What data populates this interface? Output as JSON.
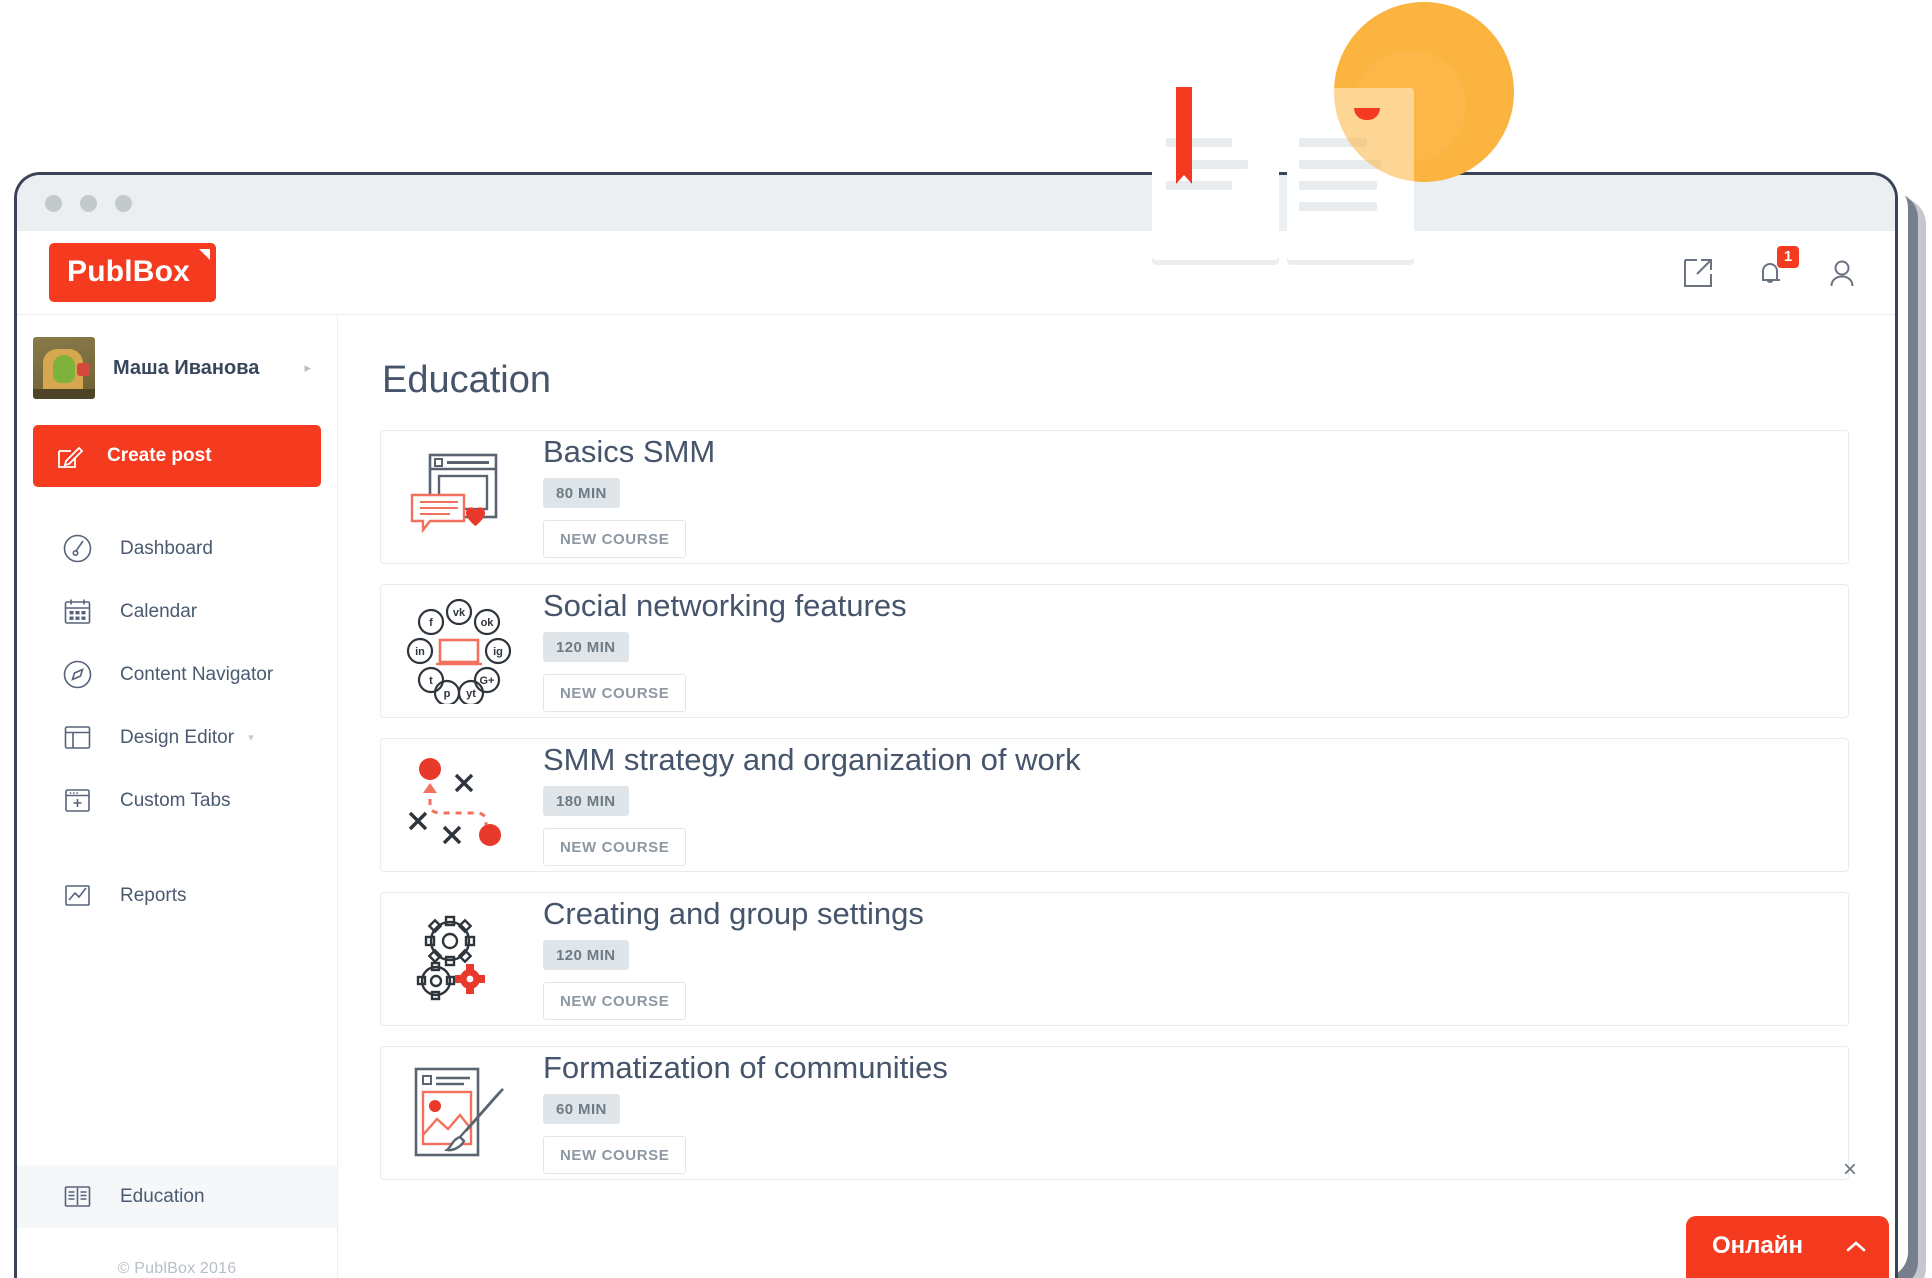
{
  "window": {
    "traffic_dots": 3
  },
  "header": {
    "logo_text": "PublBox",
    "icons": [
      {
        "name": "external-link-icon",
        "label": "Open in new window"
      },
      {
        "name": "bell-icon",
        "label": "Notifications",
        "badge": "1"
      },
      {
        "name": "user-icon",
        "label": "Account"
      }
    ],
    "notification_count": "1"
  },
  "sidebar": {
    "profile": {
      "name": "Маша Иванова",
      "caret": "▸"
    },
    "create_post": {
      "label": "Create post",
      "icon": "pencil-square-icon"
    },
    "items": [
      {
        "label": "Dashboard",
        "icon": "gauge-icon",
        "active": false,
        "caret": ""
      },
      {
        "label": "Calendar",
        "icon": "calendar-icon",
        "active": false,
        "caret": ""
      },
      {
        "label": "Content Navigator",
        "icon": "compass-icon",
        "active": false,
        "caret": ""
      },
      {
        "label": "Design Editor",
        "icon": "layout-icon",
        "active": false,
        "caret": "▾"
      },
      {
        "label": "Custom Tabs",
        "icon": "add-tab-icon",
        "active": false,
        "caret": ""
      },
      {
        "label": "Reports",
        "icon": "chart-line-icon",
        "active": false,
        "caret": ""
      }
    ],
    "bottom_item": {
      "label": "Education",
      "icon": "open-book-icon",
      "active": true
    },
    "copyright": "© PublBox 2016"
  },
  "main": {
    "page_title": "Education",
    "courses": [
      {
        "title": "Basics SMM",
        "duration": "80 MIN",
        "action": "NEW COURSE",
        "icon": "browser-comment-heart-icon"
      },
      {
        "title": "Social networking features",
        "duration": "120 MIN",
        "action": "NEW COURSE",
        "icon": "social-network-circle-icon"
      },
      {
        "title": "SMM strategy and organization of work",
        "duration": "180 MIN",
        "action": "NEW COURSE",
        "icon": "strategy-playbook-icon"
      },
      {
        "title": "Creating and group settings",
        "duration": "120 MIN",
        "action": "NEW COURSE",
        "icon": "gears-icon"
      },
      {
        "title": "Formatization of communities",
        "duration": "60 MIN",
        "action": "NEW COURSE",
        "icon": "image-brush-icon"
      }
    ]
  },
  "chat_widget": {
    "label": "Онлайн",
    "chevron": "⌃",
    "close": "×"
  },
  "illustration": {
    "name": "open-book-with-sun-illustration"
  },
  "colors": {
    "brand_red": "#f43b20",
    "sun_orange": "#fcb440",
    "text_dark": "#46556b",
    "window_border": "#3a4457",
    "badge_bg": "#dfe5e8"
  }
}
